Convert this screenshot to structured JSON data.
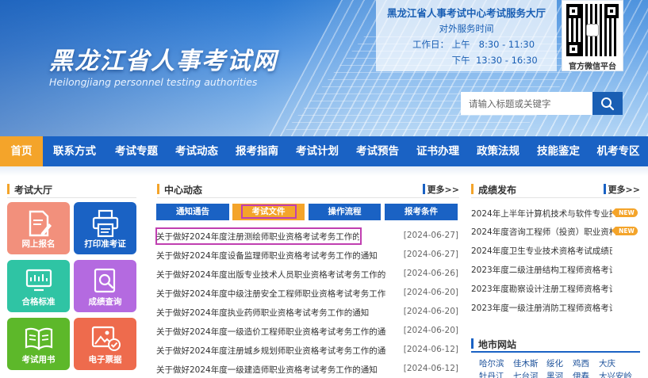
{
  "header": {
    "site_title": "黑龙江省人事考试网",
    "site_subtitle": "Heilongjiang personnel testing authorities",
    "service": {
      "title": "黑龙江省人事考试中心考试服务大厅",
      "subtitle": "对外服务时间",
      "workday_label": "工作日：",
      "am_label": "上午",
      "am_time": "8:30 - 11:30",
      "pm_label": "下午",
      "pm_time": "13:30 - 16:30"
    },
    "qr_caption": "官方微信平台",
    "search_placeholder": "请输入标题或关键字"
  },
  "nav": [
    "首页",
    "联系方式",
    "考试专题",
    "考试动态",
    "报考指南",
    "考试计划",
    "考试预告",
    "证书办理",
    "政策法规",
    "技能鉴定",
    "机考专区"
  ],
  "exam_hall": {
    "title": "考试大厅",
    "tiles": [
      {
        "label": "网上报名",
        "color": "#f2907c"
      },
      {
        "label": "打印准考证",
        "color": "#1a62c4"
      },
      {
        "label": "合格标准",
        "color": "#2fc4a4"
      },
      {
        "label": "成绩查询",
        "color": "#b46ae0"
      },
      {
        "label": "考试用书",
        "color": "#5db82a"
      },
      {
        "label": "电子票据",
        "color": "#ee6b4d"
      }
    ]
  },
  "center_news": {
    "title": "中心动态",
    "more": "更多>>",
    "tabs": [
      "通知通告",
      "考试文件",
      "操作流程",
      "报考条件"
    ],
    "items": [
      {
        "title": "关于做好2024年度注册测绘师职业资格考试考务工作的通知",
        "date": "[2024-06-27]"
      },
      {
        "title": "关于做好2024年度设备监理师职业资格考试考务工作的通知",
        "date": "[2024-06-27]"
      },
      {
        "title": "关于做好2024年度出版专业技术人员职业资格考试考务工作的通知",
        "date": "[2024-06-26]"
      },
      {
        "title": "关于做好2024年度中级注册安全工程师职业资格考试考务工作的...",
        "date": "[2024-06-20]"
      },
      {
        "title": "关于做好2024年度执业药师职业资格考试考务工作的通知",
        "date": "[2024-06-20]"
      },
      {
        "title": "关于做好2024年度一级造价工程师职业资格考试考务工作的通知",
        "date": "[2024-06-20]"
      },
      {
        "title": "关于做好2024年度注册城乡规划师职业资格考试考务工作的通知",
        "date": "[2024-06-12]"
      },
      {
        "title": "关于做好2024年度一级建造师职业资格考试考务工作的通知",
        "date": "[2024-06-12]"
      }
    ]
  },
  "results": {
    "title": "成绩发布",
    "more": "更多>>",
    "new_badge": "NEW",
    "items": [
      {
        "title": "2024年上半年计算机技术与软件专业技...",
        "new": true
      },
      {
        "title": "2024年度咨询工程师（投资）职业资格...",
        "new": true
      },
      {
        "title": "2024年度卫生专业技术资格考试成绩已...",
        "new": false
      },
      {
        "title": "2023年度二级注册结构工程师资格考试...",
        "new": false
      },
      {
        "title": "2023年度勘察设计注册工程师资格考试...",
        "new": false
      },
      {
        "title": "2023年度一级注册消防工程师资格考试...",
        "new": false
      }
    ]
  },
  "city_sites": {
    "title": "地市网站",
    "row1": [
      "哈尔滨",
      "佳木斯",
      "绥化",
      "鸡西",
      "大庆"
    ],
    "row2": [
      "牡丹江",
      "七台河",
      "黑河",
      "伊春",
      "大兴安岭"
    ]
  },
  "colors": {
    "primary_blue": "#1a62c4",
    "accent_orange": "#f4a42a",
    "highlight_magenta": "#c03fb0"
  }
}
